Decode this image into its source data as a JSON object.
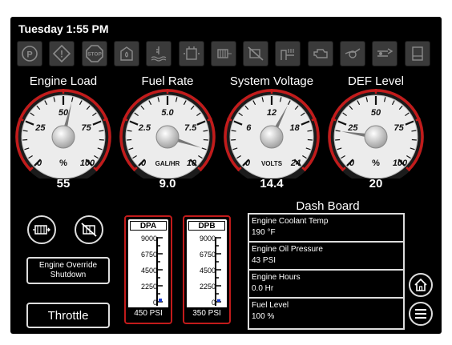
{
  "header": {
    "datetime": "Tuesday 1:55 PM"
  },
  "warning_icons": [
    {
      "name": "parking-brake-icon",
      "text": "P"
    },
    {
      "name": "warning-icon",
      "text": "!"
    },
    {
      "name": "stop-icon",
      "text": "STOP"
    },
    {
      "name": "fuel-filter-icon",
      "text": ""
    },
    {
      "name": "coolant-temp-icon",
      "text": ""
    },
    {
      "name": "battery-charge-icon",
      "text": ""
    },
    {
      "name": "dpf-regen-icon",
      "text": ""
    },
    {
      "name": "regen-inhibit-icon",
      "text": ""
    },
    {
      "name": "exhaust-temp-icon",
      "text": ""
    },
    {
      "name": "engine-check-icon",
      "text": ""
    },
    {
      "name": "oil-pressure-icon",
      "text": ""
    },
    {
      "name": "fuel-water-icon",
      "text": ""
    },
    {
      "name": "def-warning-icon",
      "text": ""
    }
  ],
  "gauges": [
    {
      "title": "Engine Load",
      "unit": "%",
      "value": 55,
      "display": "55",
      "min": 0,
      "max": 100,
      "ticks": [
        "0",
        "25",
        "50",
        "75",
        "100"
      ]
    },
    {
      "title": "Fuel Rate",
      "unit": "GAL/HR",
      "value": 9.0,
      "display": "9.0",
      "min": 0,
      "max": 10,
      "ticks": [
        "0",
        "2.5",
        "5.0",
        "7.5",
        "10"
      ]
    },
    {
      "title": "System Voltage",
      "unit": "VOLTS",
      "value": 14.4,
      "display": "14.4",
      "min": 0,
      "max": 24,
      "ticks": [
        "0",
        "6",
        "12",
        "18",
        "24"
      ]
    },
    {
      "title": "DEF Level",
      "unit": "%",
      "value": 20,
      "display": "20",
      "min": 0,
      "max": 100,
      "ticks": [
        "0",
        "25",
        "50",
        "75",
        "100"
      ]
    }
  ],
  "controls": {
    "regen_button": "dpf-regen-icon",
    "inhibit_button": "regen-inhibit-icon",
    "override_line1": "Engine Override",
    "override_line2": "Shutdown",
    "throttle_label": "Throttle"
  },
  "tanks": [
    {
      "label": "DPA",
      "ticks": [
        "9000",
        "6750",
        "4500",
        "2250",
        "0"
      ],
      "psi_label": "450 PSI",
      "level": 0.05
    },
    {
      "label": "DPB",
      "ticks": [
        "9000",
        "6750",
        "4500",
        "2250",
        "0"
      ],
      "psi_label": "350 PSI",
      "level": 0.04
    }
  ],
  "dashboard": {
    "title": "Dash Board",
    "rows": [
      {
        "label": "Engine Coolant Temp",
        "value": "190 °F"
      },
      {
        "label": "Engine Oil Pressure",
        "value": "43 PSI"
      },
      {
        "label": "Engine Hours",
        "value": "0.0 Hr"
      },
      {
        "label": "Fuel Level",
        "value": "100 %"
      }
    ]
  },
  "nav": {
    "home_icon": "home-icon",
    "menu_icon": "menu-icon"
  },
  "colors": {
    "accent_red": "#c21b1b",
    "background": "#000000",
    "needle": "#777777"
  }
}
